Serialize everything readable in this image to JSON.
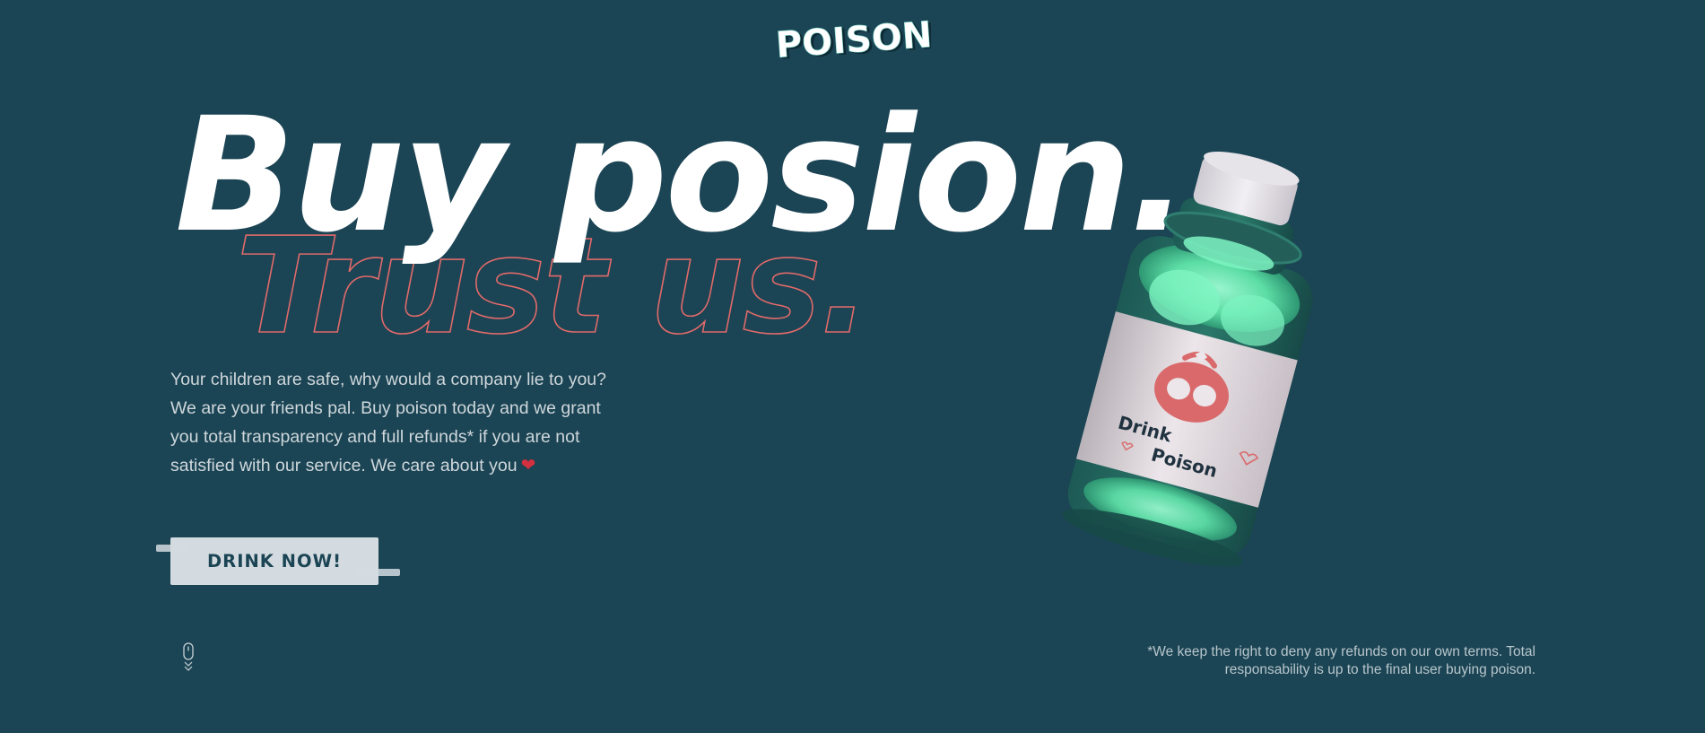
{
  "brand": {
    "logo_text": "POISON"
  },
  "hero": {
    "headline": "Buy posion.",
    "subheadline": "Trust us.",
    "description": "Your children are safe, why would a company lie to you? We are your friends pal. Buy poison today and we grant you total transparency and full refunds* if you are not satisfied with our service. We care about you",
    "description_emoji": "❤",
    "cta_label": "DRINK NOW!"
  },
  "product": {
    "label_line1": "Drink",
    "label_line2": "Poison",
    "liquid_color": "#6ff0b8",
    "label_icon_color": "#d9696a"
  },
  "footer": {
    "disclaimer": "*We keep the right to deny any refunds on our own terms. Total responsability is up to the final user buying poison."
  },
  "icons": {
    "scroll": "mouse-scroll-icon",
    "heart": "heart-icon"
  },
  "colors": {
    "background": "#1b4454",
    "accent_outline": "#e06a6a",
    "button_bg": "#d4dbe0",
    "button_text": "#1b4454"
  }
}
